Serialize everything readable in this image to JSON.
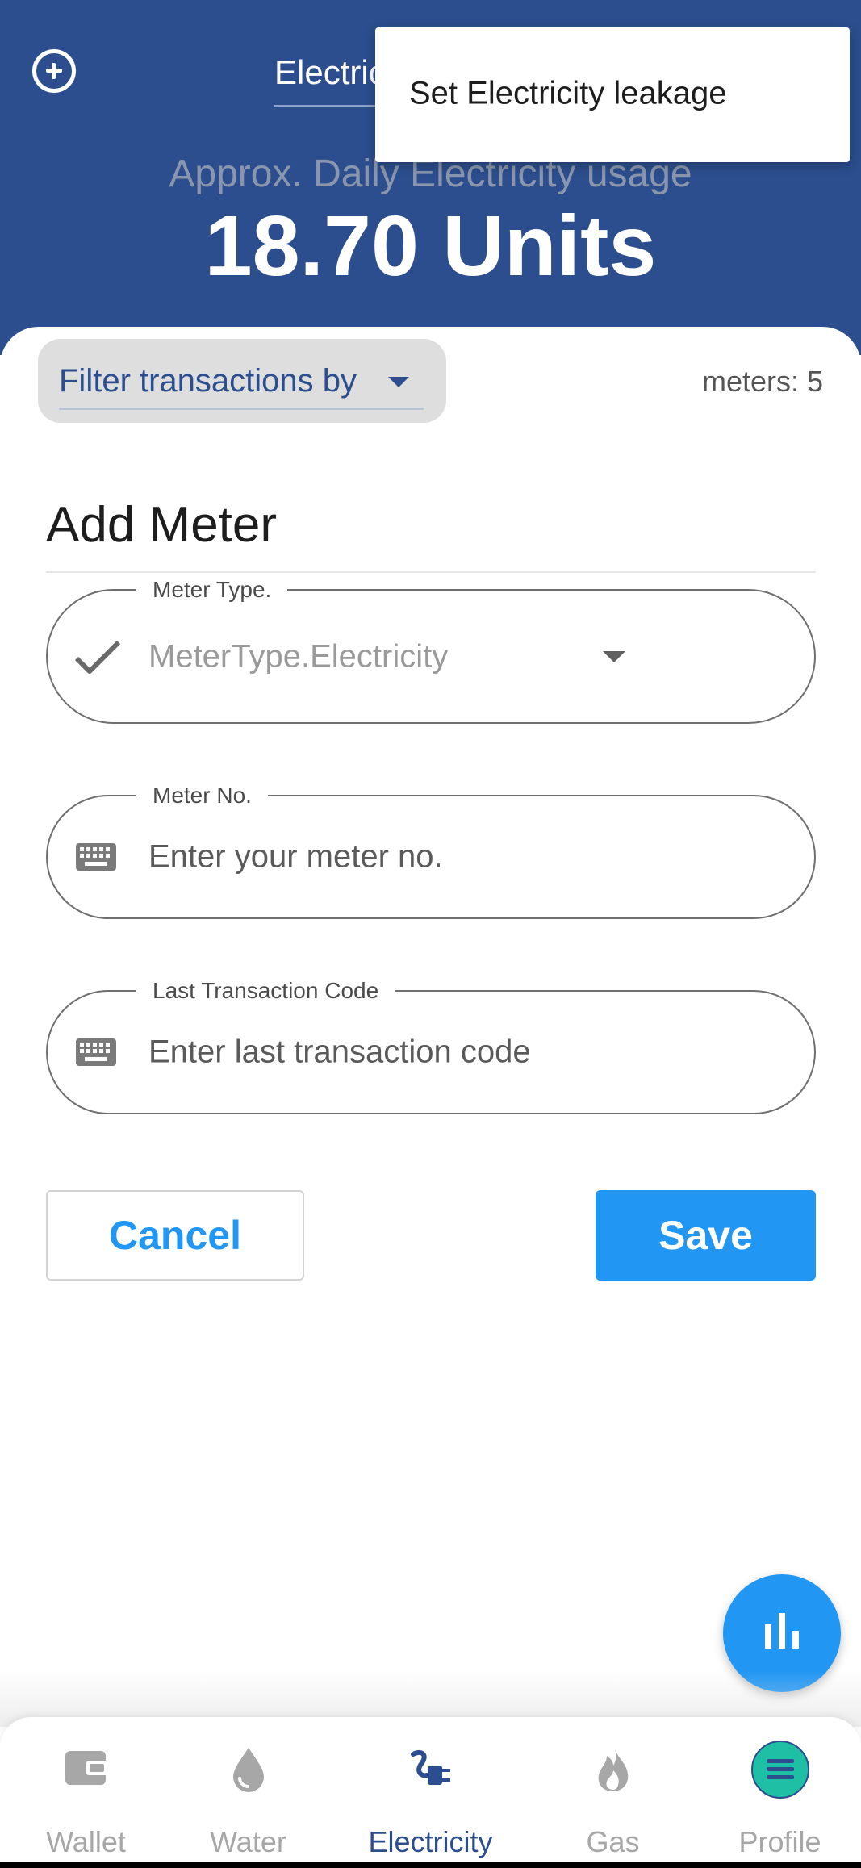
{
  "header": {
    "type_selector": "Electricity",
    "usage_label": "Approx. Daily Electricity usage",
    "usage_value": "18.70 Units"
  },
  "popup_menu": {
    "items": [
      "Set Electricity leakage"
    ]
  },
  "filter": {
    "label": "Filter transactions by",
    "meter_count": "meters: 5"
  },
  "form": {
    "title": "Add Meter",
    "meter_type": {
      "label": "Meter Type.",
      "value": "MeterType.Electricity"
    },
    "meter_no": {
      "label": "Meter No.",
      "placeholder": "Enter your meter no."
    },
    "last_transaction": {
      "label": "Last Transaction Code",
      "placeholder": "Enter last transaction code"
    },
    "cancel_label": "Cancel",
    "save_label": "Save"
  },
  "bottom_nav": {
    "items": [
      {
        "label": "Wallet",
        "icon": "wallet-icon"
      },
      {
        "label": "Water",
        "icon": "water-drop-icon"
      },
      {
        "label": "Electricity",
        "icon": "electric-plug-icon"
      },
      {
        "label": "Gas",
        "icon": "flame-icon"
      },
      {
        "label": "Profile",
        "icon": "menu-icon"
      }
    ],
    "active": "Electricity"
  },
  "colors": {
    "primary": "#2c4e8e",
    "accent": "#2196f3",
    "profile_badge": "#1fbfa6"
  }
}
